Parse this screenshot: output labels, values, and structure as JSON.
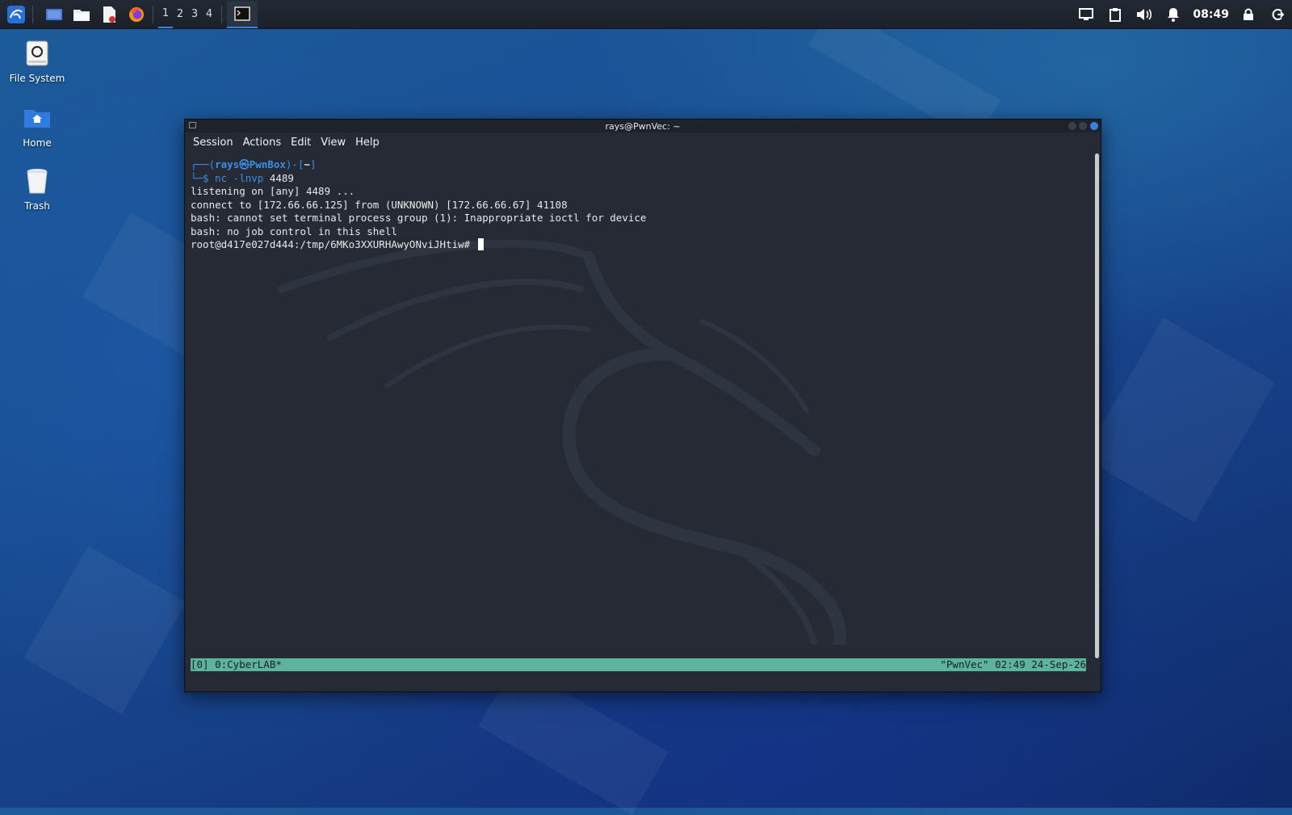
{
  "panel": {
    "workspaces": [
      "1",
      "2",
      "3",
      "4"
    ],
    "active_workspace": "1",
    "clock": "08:49",
    "icons": [
      "kali-menu-icon",
      "show-desktop-icon",
      "file-manager-icon",
      "text-editor-icon",
      "firefox-icon",
      "terminal-task-icon",
      "display-icon",
      "clipboard-icon",
      "volume-icon",
      "notification-bell-icon",
      "lock-icon",
      "logout-icon"
    ]
  },
  "desktop": {
    "icons": [
      {
        "label": "File System"
      },
      {
        "label": "Home"
      },
      {
        "label": "Trash"
      }
    ]
  },
  "window": {
    "title": "rays@PwnVec: ~",
    "menu": [
      "Session",
      "Actions",
      "Edit",
      "View",
      "Help"
    ]
  },
  "terminal": {
    "prompt_top_open": "┌──(",
    "prompt_user": "rays",
    "prompt_at": "㉿",
    "prompt_host": "PwnBox",
    "prompt_mid": ")-[",
    "prompt_dir": "~",
    "prompt_close": "]",
    "prompt_bottom": "└─$ ",
    "command": "nc -lnvp",
    "command_arg": " 4489",
    "output": [
      "listening on [any] 4489 ...",
      "connect to [172.66.66.125] from (UNKNOWN) [172.66.66.67] 41108",
      "bash: cannot set terminal process group (1): Inappropriate ioctl for device",
      "bash: no job control in this shell"
    ],
    "shell_prompt": "root@d417e027d444:/tmp/6MKo3XXURHAwyONviJHtiw# "
  },
  "tmux": {
    "left": "[0] 0:CyberLAB*",
    "right": "\"PwnVec\" 02:49 24-Sep-26"
  },
  "colors": {
    "accent": "#3584e4",
    "terminal_bg": "#252a34",
    "tmux_bar": "#5bb49b",
    "prompt_blue": "#3b8eea"
  }
}
